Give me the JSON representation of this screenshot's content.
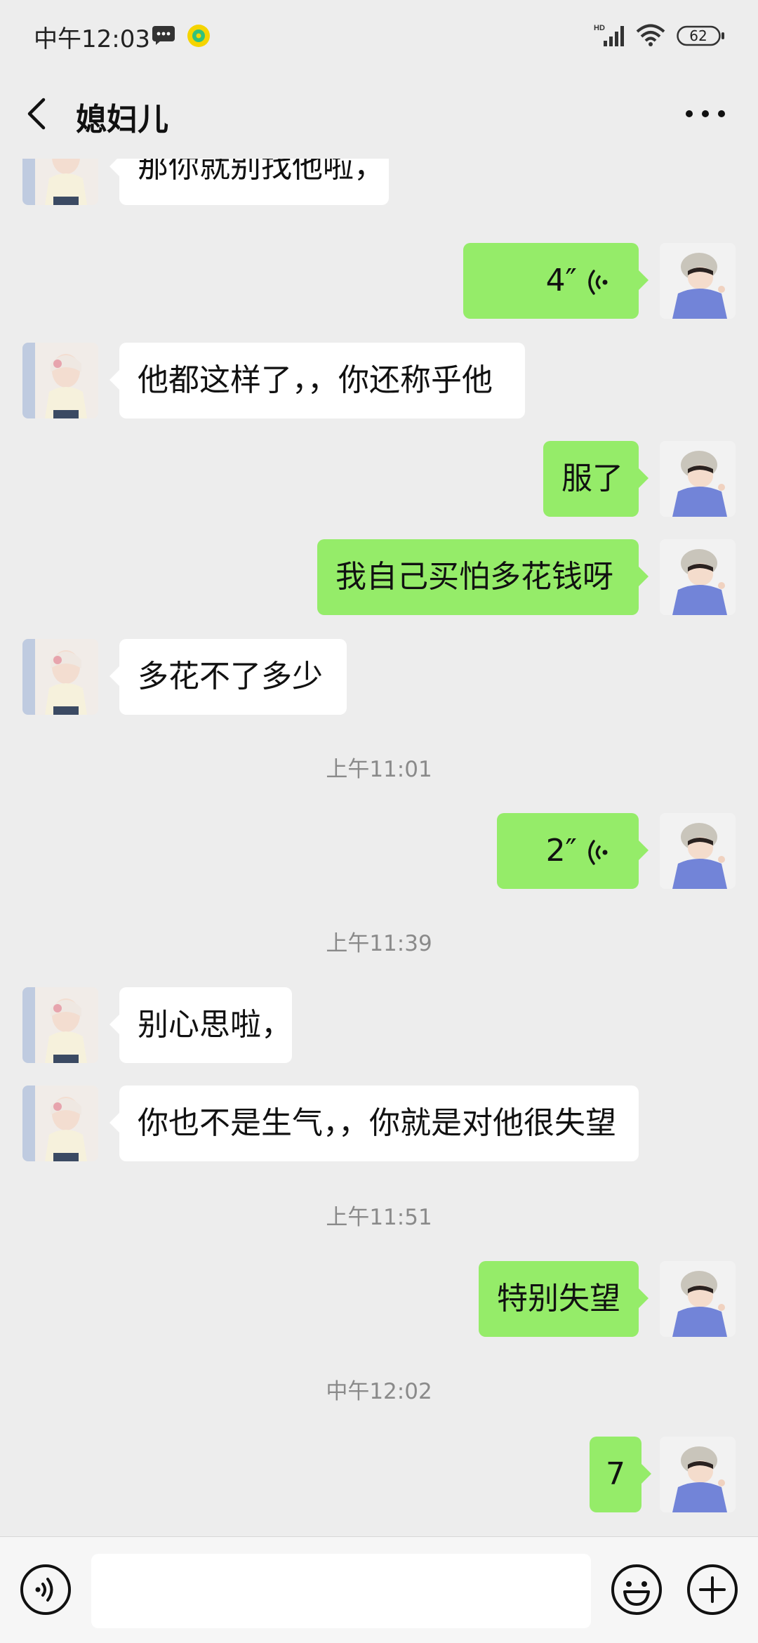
{
  "status_bar": {
    "time": "中午12:03",
    "battery": "62",
    "network_badge": "HD"
  },
  "header": {
    "title": "媳妇儿",
    "back_icon": "chevron-left-icon",
    "more_icon": "more-dots-icon"
  },
  "messages": [
    {
      "side": "in",
      "type": "text",
      "text": "那你就别找他啦，"
    },
    {
      "side": "out",
      "type": "voice",
      "duration": "4″"
    },
    {
      "side": "in",
      "type": "text",
      "text": "他都这样了，，你还称乎他"
    },
    {
      "side": "out",
      "type": "text",
      "text": "服了"
    },
    {
      "side": "out",
      "type": "text",
      "text": "我自己买怕多花钱呀"
    },
    {
      "side": "in",
      "type": "text",
      "text": "多花不了多少"
    },
    {
      "type": "time",
      "text": "上午11:01"
    },
    {
      "side": "out",
      "type": "voice",
      "duration": "2″"
    },
    {
      "type": "time",
      "text": "上午11:39"
    },
    {
      "side": "in",
      "type": "text",
      "text": "别心思啦，"
    },
    {
      "side": "in",
      "type": "text",
      "text": "你也不是生气，，你就是对他很失望"
    },
    {
      "type": "time",
      "text": "上午11:51"
    },
    {
      "side": "out",
      "type": "text",
      "text": "特别失望"
    },
    {
      "type": "time",
      "text": "中午12:02"
    },
    {
      "side": "out",
      "type": "text",
      "text": "7"
    }
  ],
  "input_bar": {
    "value": "",
    "voice_icon": "voice-toggle-icon",
    "emoji_icon": "emoji-icon",
    "plus_icon": "plus-icon"
  },
  "colors": {
    "background": "#ededed",
    "outgoing_bubble": "#95ec69",
    "incoming_bubble": "#ffffff",
    "timestamp": "#8a8a8a"
  }
}
